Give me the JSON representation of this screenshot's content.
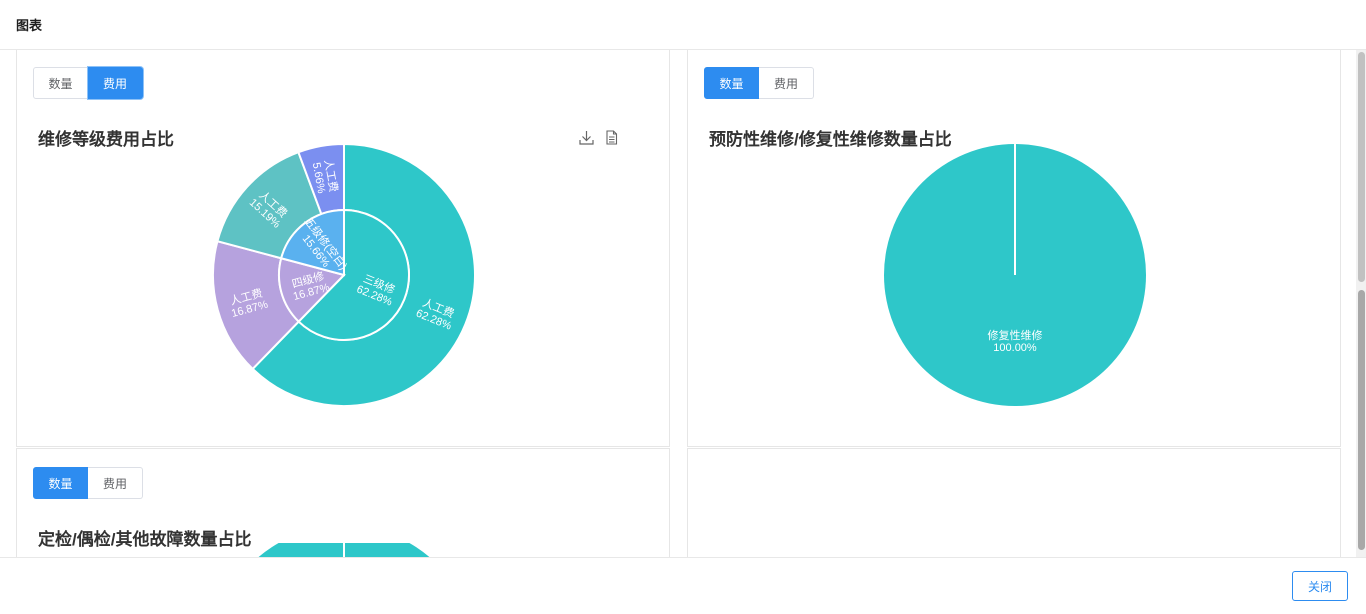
{
  "header": {
    "title": "图表"
  },
  "toggle_labels": {
    "count": "数量",
    "cost": "费用"
  },
  "cards": [
    {
      "title": "维修等级费用占比",
      "active_toggle": "cost",
      "tools": [
        "download-icon",
        "data-view-icon"
      ]
    },
    {
      "title": "预防性维修/修复性维修数量占比",
      "active_toggle": "count"
    },
    {
      "title": "定检/偶检/其他故障数量占比",
      "active_toggle": "count"
    }
  ],
  "footer": {
    "close_label": "关闭"
  },
  "chart_data": [
    {
      "type": "pie",
      "title": "维修等级费用占比",
      "inner_series": [
        {
          "name": "三级修",
          "value": 62.28,
          "color": "#2ec7c9"
        },
        {
          "name": "四级修",
          "value": 16.87,
          "color": "#b6a2de"
        },
        {
          "name": "五级修(空白)",
          "value": 20.85,
          "color": "#5ab1ef"
        }
      ],
      "outer_series": [
        {
          "name": "人工费",
          "value": 62.28,
          "color": "#2ec7c9"
        },
        {
          "name": "人工费",
          "value": 16.87,
          "color": "#b6a2de"
        },
        {
          "name": "人工费",
          "value": 15.19,
          "color": "#5ec2c4"
        },
        {
          "name": "人工费",
          "value": 5.66,
          "color": "#7b8ff0"
        }
      ],
      "inner_labels": [
        {
          "name": "三级修",
          "pct": "62.28%"
        },
        {
          "name": "四级修",
          "pct": "16.87%"
        },
        {
          "name": "五级修(空白)",
          "pct": "15.66%"
        }
      ],
      "outer_labels": [
        {
          "name": "人工费",
          "pct": "62.28%"
        },
        {
          "name": "人工费",
          "pct": "16.87%"
        },
        {
          "name": "人工费",
          "pct": "15.19%"
        },
        {
          "name": "人工费",
          "pct": "5.66%"
        }
      ]
    },
    {
      "type": "pie",
      "title": "预防性维修/修复性维修数量占比",
      "slices": [
        {
          "name": "修复性维修",
          "value": 100.0,
          "pct": "100.00%",
          "color": "#2ec7c9"
        }
      ]
    }
  ]
}
